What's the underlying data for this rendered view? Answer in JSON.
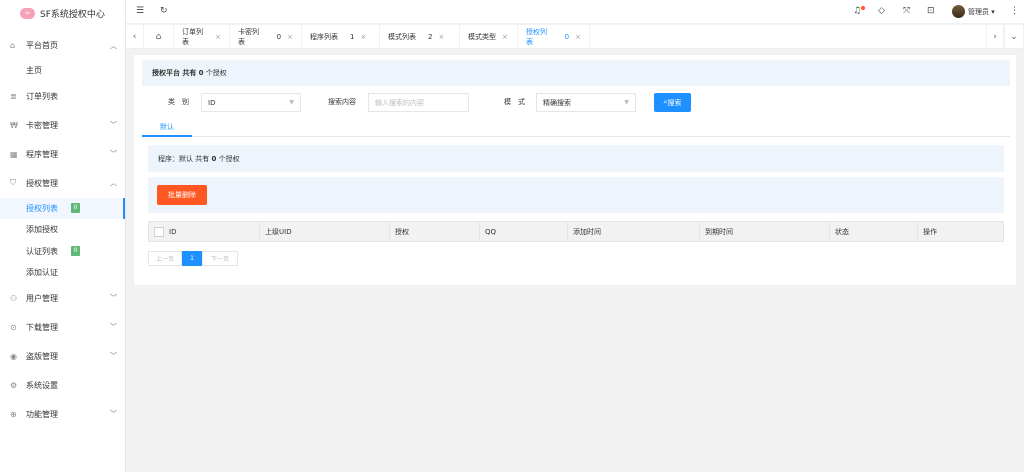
{
  "logo": {
    "text": "SF系统授权中心",
    "icon_text": "∞"
  },
  "sidebar": {
    "items": [
      {
        "label": "平台首页",
        "icon": "home-icon",
        "arrow": "up"
      },
      {
        "label": "主页",
        "sub": true
      },
      {
        "label": "订单列表",
        "icon": "list-icon"
      },
      {
        "label": "卡密管理",
        "icon": "key-icon",
        "arrow": "down"
      },
      {
        "label": "程序管理",
        "icon": "app-icon",
        "arrow": "down"
      },
      {
        "label": "授权管理",
        "icon": "shield-icon",
        "arrow": "up"
      },
      {
        "label": "授权列表",
        "sub": true,
        "active": true,
        "badge": "0"
      },
      {
        "label": "添加授权",
        "sub": true
      },
      {
        "label": "认证列表",
        "sub": true,
        "badge": "0"
      },
      {
        "label": "添加认证",
        "sub": true
      },
      {
        "label": "用户管理",
        "icon": "user-icon",
        "arrow": "down"
      },
      {
        "label": "下载管理",
        "icon": "download-icon",
        "arrow": "down"
      },
      {
        "label": "盗版管理",
        "icon": "eye-icon",
        "arrow": "down"
      },
      {
        "label": "系统设置",
        "icon": "gear-icon"
      },
      {
        "label": "功能管理",
        "icon": "function-icon",
        "arrow": "down"
      }
    ]
  },
  "header": {
    "user": "管理员"
  },
  "tabs": [
    {
      "label": "订单列表"
    },
    {
      "label": "卡密列表",
      "num": "0"
    },
    {
      "label": "程序列表",
      "num": "1"
    },
    {
      "label": "模式列表",
      "num": "2"
    },
    {
      "label": "模式类型"
    },
    {
      "label": "授权列表",
      "num": "0",
      "active": true
    }
  ],
  "notice": {
    "prefix": "授权平台 共有 ",
    "count": "0",
    "suffix": " 个授权"
  },
  "search": {
    "category_label": "类　别",
    "category_value": "ID",
    "content_label": "搜索内容",
    "content_placeholder": "输入搜索的内容",
    "mode_label": "模　式",
    "mode_value": "精确搜索",
    "button": "搜索"
  },
  "subtab": "默认",
  "notice2": {
    "prefix": "程序：默认 共有 ",
    "count": "0",
    "suffix": " 个授权"
  },
  "batch_delete": "批量删除",
  "table": {
    "columns": [
      "ID",
      "上级UID",
      "授权",
      "QQ",
      "添加时间",
      "到期时间",
      "状态",
      "操作"
    ]
  },
  "pager": {
    "prev": "上一页",
    "current": "1",
    "next": "下一页"
  }
}
